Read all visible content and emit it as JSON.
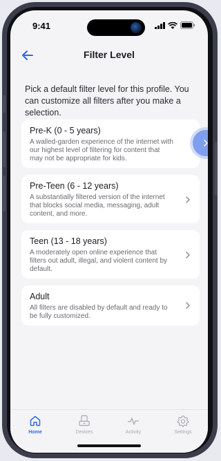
{
  "status_bar": {
    "time": "9:41"
  },
  "nav": {
    "title": "Filter Level",
    "back_icon": "arrow-left-icon"
  },
  "intro": "Pick a default filter level for this profile. You can customize all filters after you make a selection.",
  "options": [
    {
      "title": "Pre-K (0 - 5 years)",
      "description": "A walled-garden experience of the internet with our highest level of filtering for content that may not be appropriate for kids.",
      "highlighted": true
    },
    {
      "title": "Pre-Teen (6 - 12 years)",
      "description": "A substantially filtered version of the internet that blocks social media, messaging, adult content, and more."
    },
    {
      "title": "Teen (13 - 18 years)",
      "description": "A moderately open online experience that filters out adult, illegal, and violent content by default."
    },
    {
      "title": "Adult",
      "description": "All filters are disabled by default and ready to be fully customized."
    }
  ],
  "tabs": [
    {
      "label": "Home",
      "icon": "home-icon",
      "active": true
    },
    {
      "label": "Devices",
      "icon": "devices-icon",
      "active": false
    },
    {
      "label": "Activity",
      "icon": "activity-icon",
      "active": false
    },
    {
      "label": "Settings",
      "icon": "settings-gear-icon",
      "active": false
    }
  ],
  "colors": {
    "accent": "#2f6be0",
    "highlight": "#7f9fee",
    "background": "#f4f4f6"
  }
}
